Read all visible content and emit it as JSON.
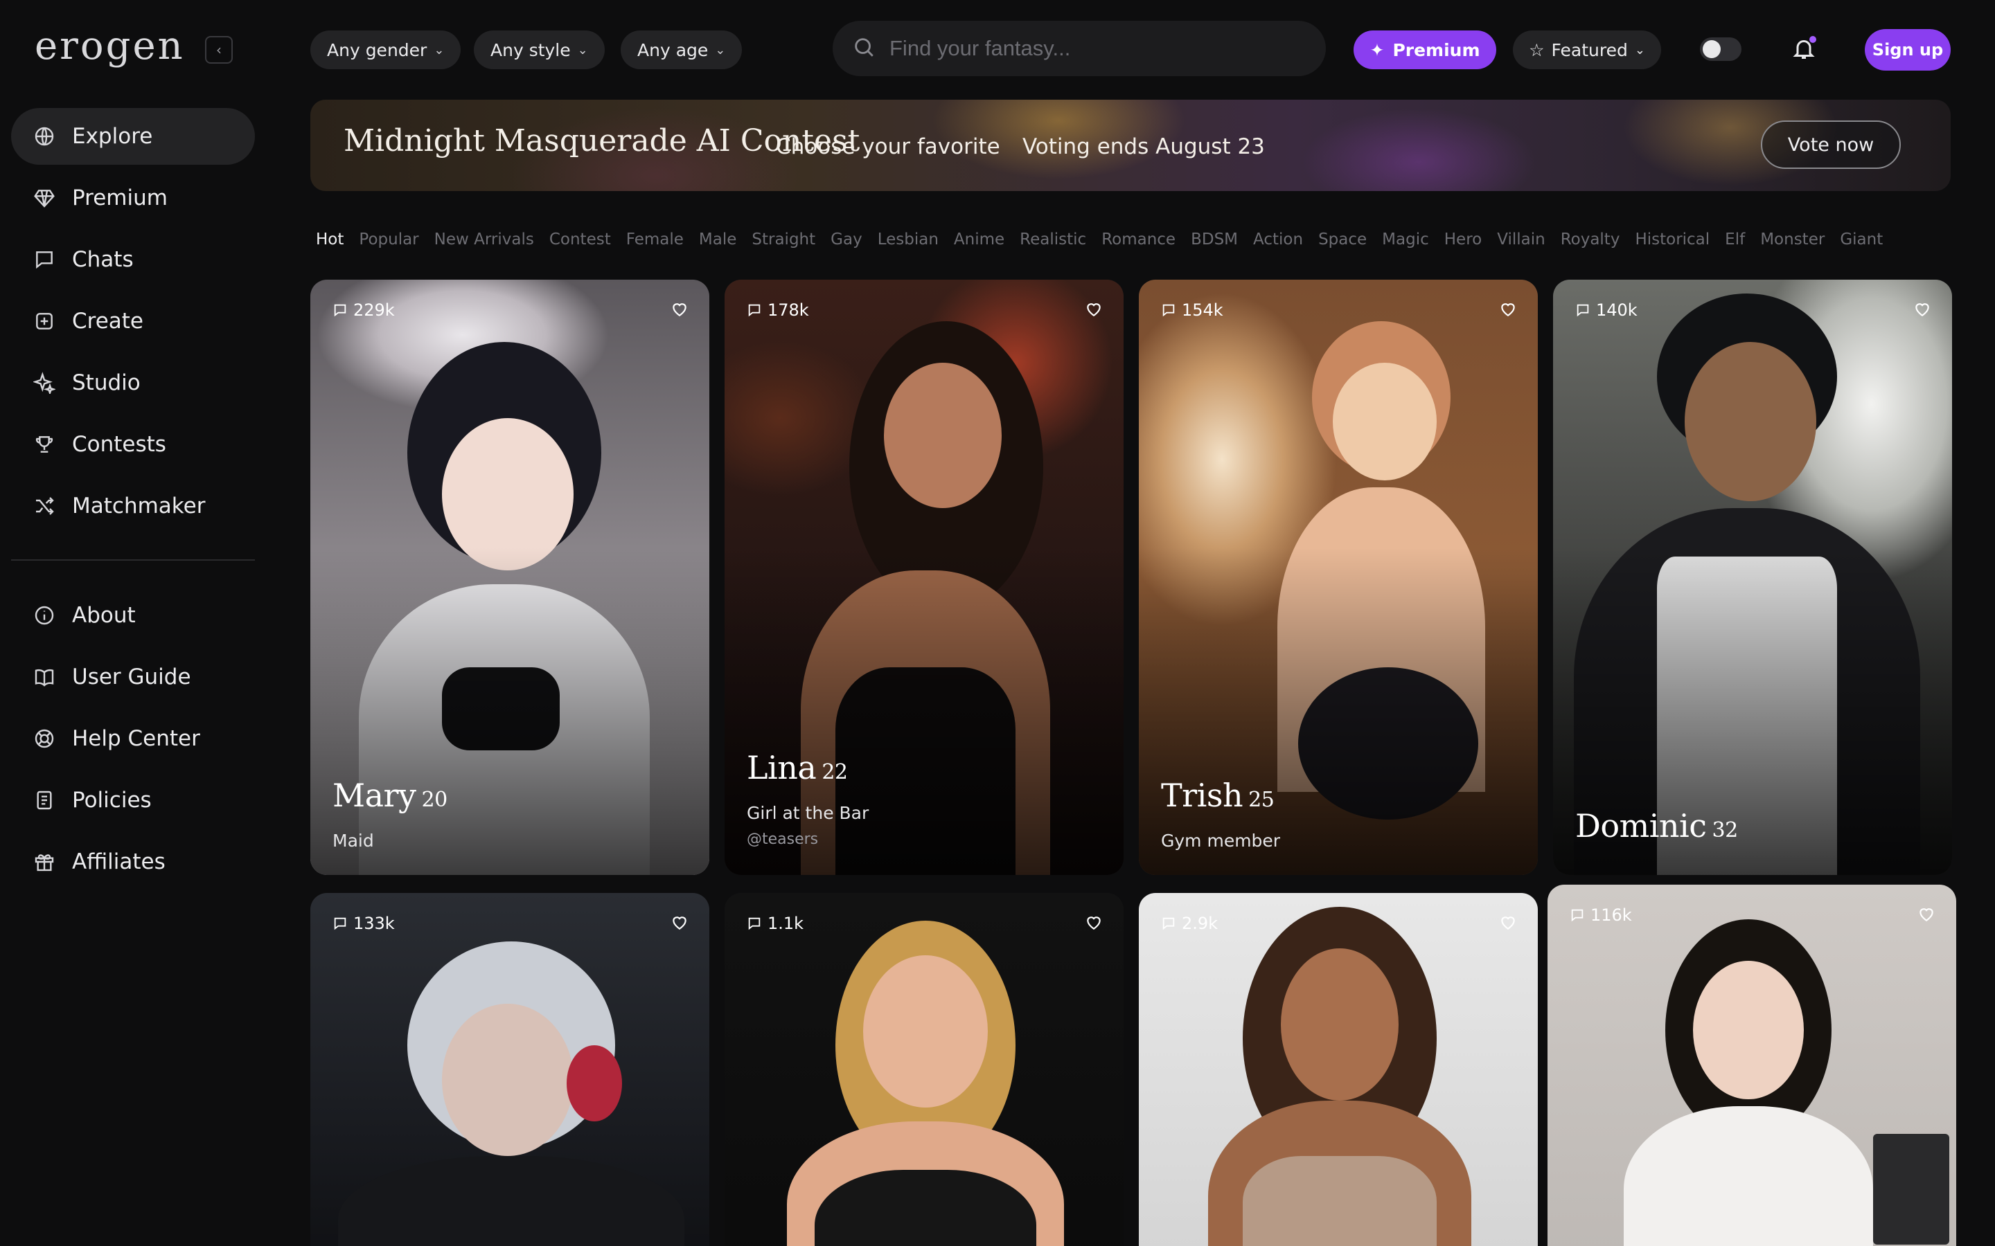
{
  "app": {
    "logo": "erogen"
  },
  "sidebar": {
    "collapse_icon": "chevron-left-icon",
    "primary": [
      {
        "label": "Explore",
        "icon": "globe-icon",
        "active": true
      },
      {
        "label": "Premium",
        "icon": "gem-icon"
      },
      {
        "label": "Chats",
        "icon": "chat-icon"
      },
      {
        "label": "Create",
        "icon": "plus-square-icon"
      },
      {
        "label": "Studio",
        "icon": "sparkles-icon"
      },
      {
        "label": "Contests",
        "icon": "trophy-icon"
      },
      {
        "label": "Matchmaker",
        "icon": "shuffle-icon"
      }
    ],
    "secondary": [
      {
        "label": "About",
        "icon": "info-icon"
      },
      {
        "label": "User Guide",
        "icon": "book-icon"
      },
      {
        "label": "Help Center",
        "icon": "lifebuoy-icon"
      },
      {
        "label": "Policies",
        "icon": "document-icon"
      },
      {
        "label": "Affiliates",
        "icon": "gift-icon"
      }
    ]
  },
  "topbar": {
    "filters": [
      "Any gender",
      "Any style",
      "Any age"
    ],
    "search_placeholder": "Find your fantasy...",
    "premium_label": "Premium",
    "featured_label": "Featured",
    "signup_label": "Sign up"
  },
  "banner": {
    "title": "Midnight Masquerade AI Contest",
    "subtitle": "Choose your favorite",
    "deadline": "Voting ends August 23",
    "cta": "Vote now"
  },
  "categories": [
    "Hot",
    "Popular",
    "New Arrivals",
    "Contest",
    "Female",
    "Male",
    "Straight",
    "Gay",
    "Lesbian",
    "Anime",
    "Realistic",
    "Romance",
    "BDSM",
    "Action",
    "Space",
    "Magic",
    "Hero",
    "Villain",
    "Royalty",
    "Historical",
    "Elf",
    "Monster",
    "Giant"
  ],
  "active_category": "Hot",
  "cards": [
    {
      "count": "229k",
      "name": "Mary",
      "age": "20",
      "role": "Maid",
      "handle": ""
    },
    {
      "count": "178k",
      "name": "Lina",
      "age": "22",
      "role": "Girl at the Bar",
      "handle": "@teasers"
    },
    {
      "count": "154k",
      "name": "Trish",
      "age": "25",
      "role": "Gym member",
      "handle": ""
    },
    {
      "count": "140k",
      "name": "Dominic",
      "age": "32",
      "role": "",
      "handle": ""
    },
    {
      "count": "133k",
      "name": "",
      "age": "",
      "role": "",
      "handle": ""
    },
    {
      "count": "1.1k",
      "name": "",
      "age": "",
      "role": "",
      "handle": ""
    },
    {
      "count": "2.9k",
      "name": "",
      "age": "",
      "role": "",
      "handle": ""
    },
    {
      "count": "116k",
      "name": "",
      "age": "",
      "role": "",
      "handle": ""
    }
  ],
  "colors": {
    "accent": "#8a3ef0",
    "background": "#0d0d0e",
    "surface": "#232325"
  }
}
